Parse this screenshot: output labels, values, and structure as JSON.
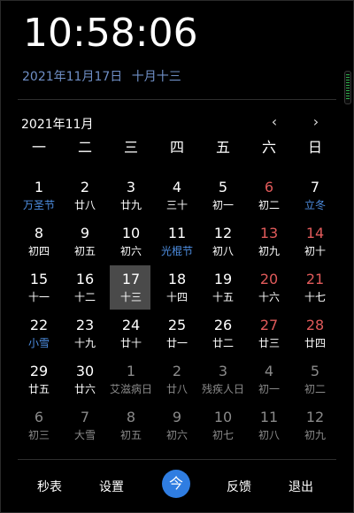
{
  "clock": {
    "time": "10:58:06"
  },
  "date": {
    "gregorian": "2021年11月17日",
    "lunar": "十月十三"
  },
  "calendar": {
    "month_title": "2021年11月",
    "prev_label": "‹",
    "next_label": "›",
    "weekdays": [
      "一",
      "二",
      "三",
      "四",
      "五",
      "六",
      "日"
    ],
    "weeks": [
      [
        {
          "d": "1",
          "l": "万圣节",
          "festival": true
        },
        {
          "d": "2",
          "l": "廿八"
        },
        {
          "d": "3",
          "l": "廿九"
        },
        {
          "d": "4",
          "l": "三十"
        },
        {
          "d": "5",
          "l": "初一"
        },
        {
          "d": "6",
          "l": "初二",
          "weekend": true
        },
        {
          "d": "7",
          "l": "立冬",
          "festival": true
        }
      ],
      [
        {
          "d": "8",
          "l": "初四"
        },
        {
          "d": "9",
          "l": "初五"
        },
        {
          "d": "10",
          "l": "初六"
        },
        {
          "d": "11",
          "l": "光棍节",
          "festival": true
        },
        {
          "d": "12",
          "l": "初八"
        },
        {
          "d": "13",
          "l": "初九",
          "weekend": true
        },
        {
          "d": "14",
          "l": "初十",
          "weekend": true
        }
      ],
      [
        {
          "d": "15",
          "l": "十一"
        },
        {
          "d": "16",
          "l": "十二"
        },
        {
          "d": "17",
          "l": "十三",
          "today": true
        },
        {
          "d": "18",
          "l": "十四"
        },
        {
          "d": "19",
          "l": "十五"
        },
        {
          "d": "20",
          "l": "十六",
          "weekend": true
        },
        {
          "d": "21",
          "l": "十七",
          "weekend": true
        }
      ],
      [
        {
          "d": "22",
          "l": "小雪",
          "festival": true
        },
        {
          "d": "23",
          "l": "十九"
        },
        {
          "d": "24",
          "l": "廿十"
        },
        {
          "d": "25",
          "l": "廿一"
        },
        {
          "d": "26",
          "l": "廿二"
        },
        {
          "d": "27",
          "l": "廿三",
          "weekend": true
        },
        {
          "d": "28",
          "l": "廿四",
          "weekend": true
        }
      ],
      [
        {
          "d": "29",
          "l": "廿五"
        },
        {
          "d": "30",
          "l": "廿六"
        },
        {
          "d": "1",
          "l": "艾滋病日",
          "other": true
        },
        {
          "d": "2",
          "l": "廿八",
          "other": true
        },
        {
          "d": "3",
          "l": "残疾人日",
          "other": true
        },
        {
          "d": "4",
          "l": "初一",
          "other": true
        },
        {
          "d": "5",
          "l": "初二",
          "other": true
        }
      ],
      [
        {
          "d": "6",
          "l": "初三",
          "other": true
        },
        {
          "d": "7",
          "l": "大雪",
          "other": true
        },
        {
          "d": "8",
          "l": "初五",
          "other": true
        },
        {
          "d": "9",
          "l": "初六",
          "other": true
        },
        {
          "d": "10",
          "l": "初七",
          "other": true
        },
        {
          "d": "11",
          "l": "初八",
          "other": true
        },
        {
          "d": "12",
          "l": "初九",
          "other": true
        }
      ]
    ]
  },
  "footer": {
    "stopwatch": "秒表",
    "settings": "设置",
    "today": "今",
    "feedback": "反馈",
    "exit": "退出"
  },
  "colors": {
    "accent": "#2f7de1",
    "festival": "#4d8de0",
    "weekend": "#e05a5a",
    "date_line": "#6f8fc6",
    "today_bg": "#4a4a4a"
  },
  "icons": {
    "prev": "chevron-left-icon",
    "next": "chevron-right-icon",
    "scroll": "scroll-grip-icon"
  }
}
